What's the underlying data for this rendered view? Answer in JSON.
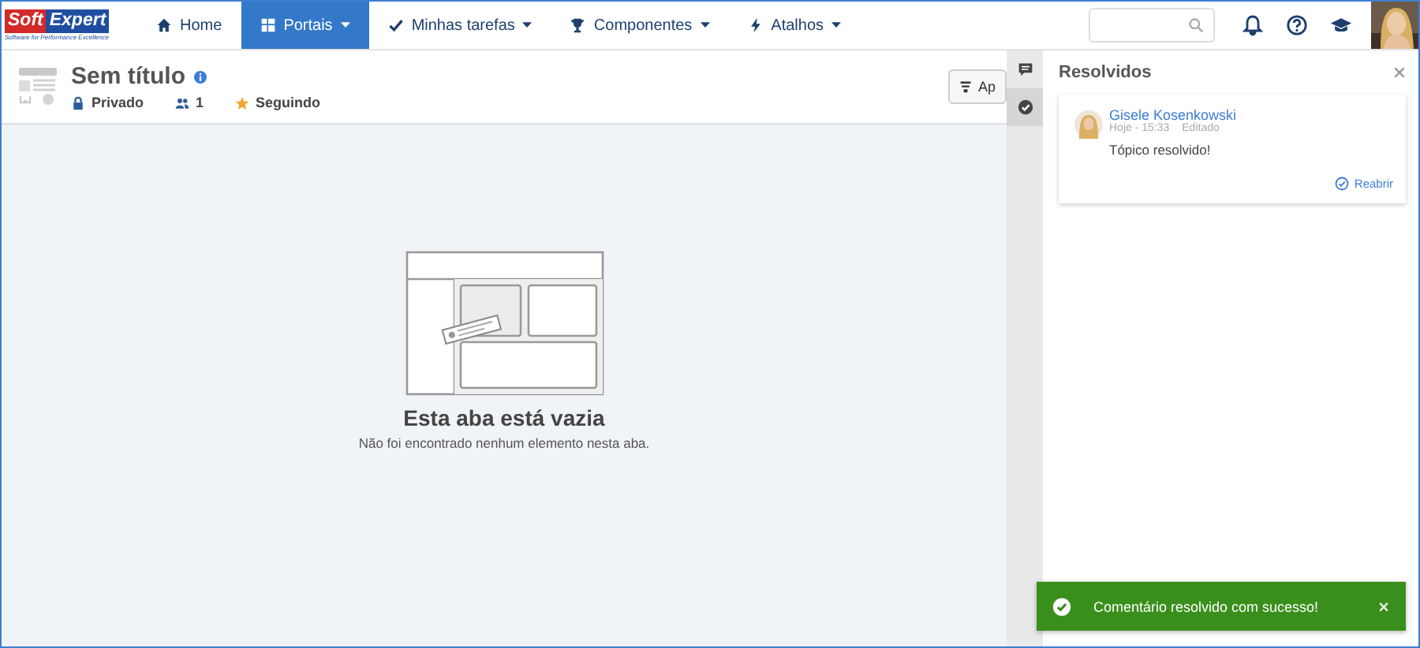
{
  "logo": {
    "left": "Soft",
    "right": "Expert",
    "tagline": "Software for Performance Excellence"
  },
  "nav": [
    {
      "label": "Home",
      "selected": false,
      "menu": false
    },
    {
      "label": "Portais",
      "selected": true,
      "menu": true
    },
    {
      "label": "Minhas tarefas",
      "selected": false,
      "menu": true
    },
    {
      "label": "Componentes",
      "selected": false,
      "menu": true
    },
    {
      "label": "Atalhos",
      "selected": false,
      "menu": true
    }
  ],
  "page": {
    "title": "Sem título",
    "privacy": "Privado",
    "members": "1",
    "follow": "Seguindo",
    "button": "Ap"
  },
  "empty": {
    "title": "Esta aba está vazia",
    "text": "Não foi encontrado nenhum elemento nesta aba."
  },
  "side_tabs": [
    {
      "selected": false
    },
    {
      "selected": true
    }
  ],
  "panel": {
    "title": "Resolvidos",
    "comments": [
      {
        "author": "Gisele Kosenkowski",
        "time": "Hoje - 15:33",
        "edited": "Editado",
        "text": "Tópico resolvido!",
        "action": "Reabrir"
      }
    ]
  },
  "toast": {
    "text": "Comentário resolvido com sucesso!"
  }
}
